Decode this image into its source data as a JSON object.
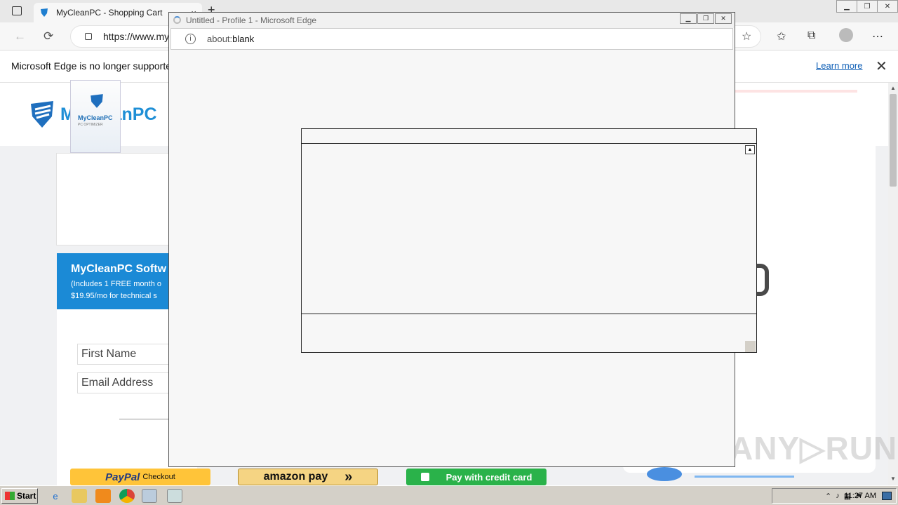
{
  "browser": {
    "tab_title": "MyCleanPC - Shopping Cart",
    "tab_close": "×",
    "new_tab": "+",
    "url": "https://www.my",
    "infobar_message": "Microsoft Edge is no longer supported",
    "infobar_link": "Learn more",
    "infobar_close": "✕",
    "controls": {
      "minimize": "▁",
      "restore": "❐",
      "close": "✕"
    }
  },
  "page": {
    "logo_text": "MyCleanPC",
    "box_brand": "MyCleanPC",
    "box_sub": "PC OPTIMIZER",
    "product_title": "MyCleanPC Softw",
    "product_sub1": "(Includes 1 FREE month o",
    "product_sub2": "$19.95/mo for technical s",
    "first_name_placeholder": "First Name",
    "email_placeholder": "Email Address",
    "paypal_label": "PayPal",
    "paypal_checkout": "Checkout",
    "amazon_label": "amazon pay",
    "amazon_arrows": "»",
    "card_label": "Pay with credit card"
  },
  "popup": {
    "title": "Untitled - Profile 1 - Microsoft Edge",
    "address_prefix": "about:",
    "address_rest": "blank",
    "controls": {
      "minimize": "▁",
      "restore": "❐",
      "close": "✕"
    }
  },
  "watermark": "ANY▷RUN",
  "taskbar": {
    "start_label": "Start",
    "clock": "11:27 AM"
  }
}
